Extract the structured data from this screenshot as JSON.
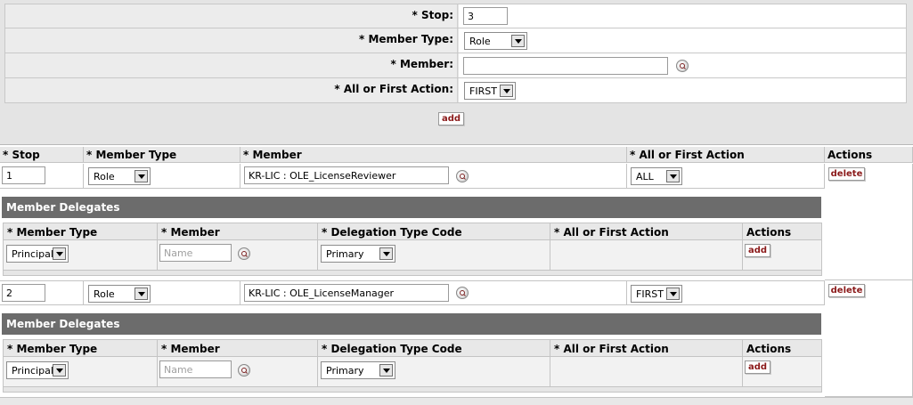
{
  "add_form": {
    "stop_label": "* Stop:",
    "stop_value": "3",
    "member_type_label": "* Member Type:",
    "member_type_value": "Role",
    "member_label": "* Member:",
    "member_value": "",
    "action_label": "* All or First Action:",
    "action_value": "FIRST",
    "add_label": "add"
  },
  "table": {
    "headers": [
      "* Stop",
      "* Member Type",
      "* Member",
      "* All or First Action",
      "Actions"
    ],
    "rows": [
      {
        "stop": "1",
        "member_type": "Role",
        "member": "KR-LIC : OLE_LicenseReviewer",
        "action": "ALL",
        "delete_label": "delete",
        "delegates": {
          "title": "Member Delegates",
          "headers": [
            "* Member Type",
            "* Member",
            "* Delegation Type Code",
            "* All or First Action",
            "Actions"
          ],
          "member_type": "Principal",
          "member_placeholder": "Name",
          "delegation_type": "Primary",
          "add_label": "add"
        }
      },
      {
        "stop": "2",
        "member_type": "Role",
        "member": "KR-LIC : OLE_LicenseManager",
        "action": "FIRST",
        "delete_label": "delete",
        "delegates": {
          "title": "Member Delegates",
          "headers": [
            "* Member Type",
            "* Member",
            "* Delegation Type Code",
            "* All or First Action",
            "Actions"
          ],
          "member_type": "Principal",
          "member_placeholder": "Name",
          "delegation_type": "Primary",
          "add_label": "add"
        }
      }
    ]
  }
}
